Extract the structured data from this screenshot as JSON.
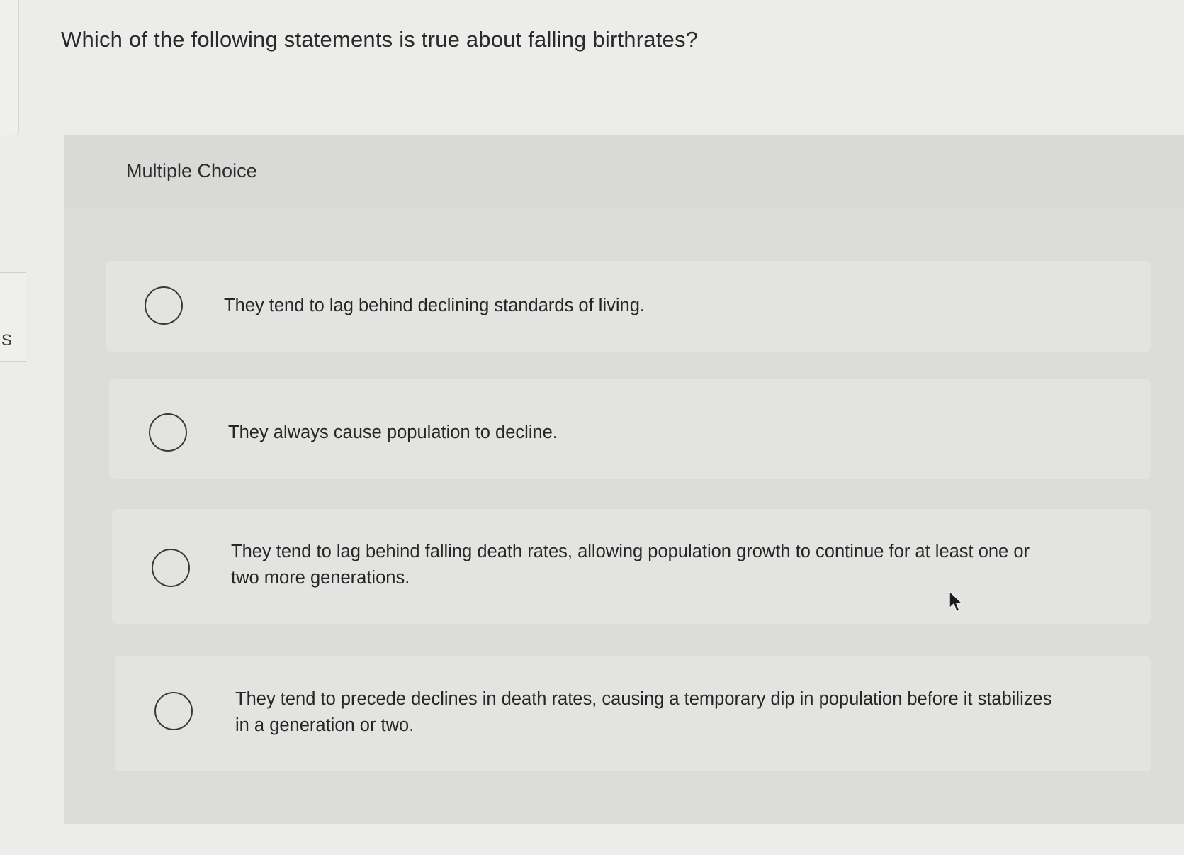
{
  "sidebar": {
    "tab_letter": "S"
  },
  "question": {
    "text": "Which of the following statements is true about falling birthrates?"
  },
  "answer_panel": {
    "header": "Multiple Choice",
    "options": [
      {
        "label": "They tend to lag behind declining standards of living."
      },
      {
        "label": "They always cause population to decline."
      },
      {
        "label": "They tend to lag behind falling death rates, allowing population growth to continue for at least one or two more generations."
      },
      {
        "label": "They tend to precede declines in death rates, causing a temporary dip in population before it stabilizes in a generation or two."
      }
    ]
  },
  "colors": {
    "page_background": "#ececea",
    "panel_background": "#dcdcda",
    "option_background": "#e3e3e1",
    "text": "#2b2b2b"
  },
  "icons": {
    "cursor": "mouse-pointer-icon",
    "radio": "radio-button-icon"
  }
}
